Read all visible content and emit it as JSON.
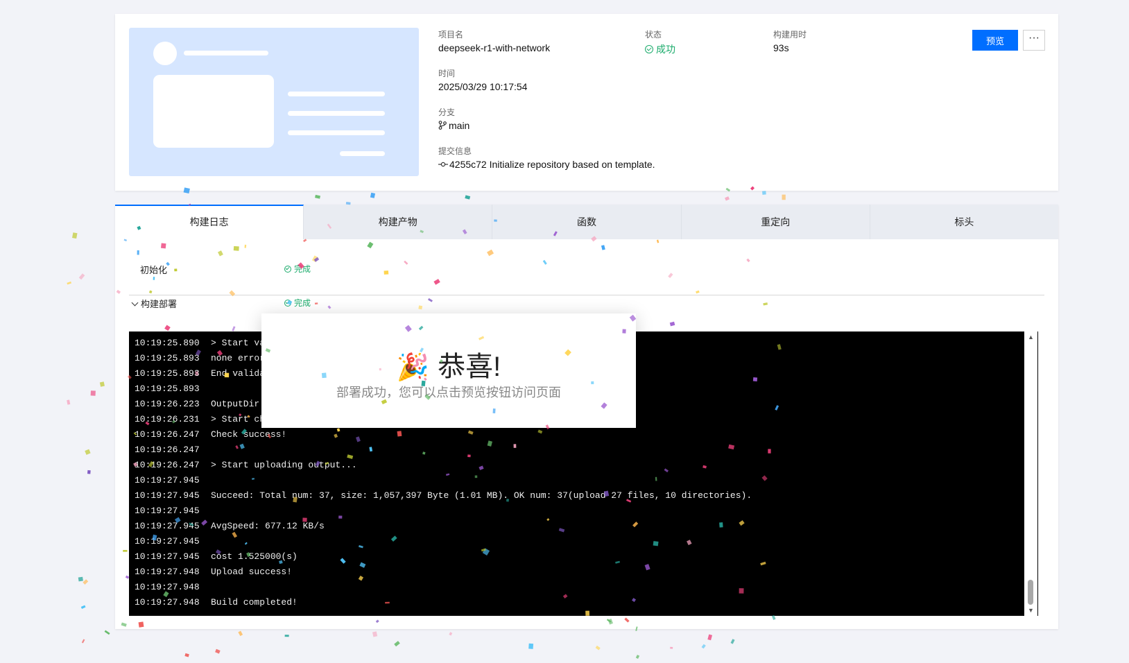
{
  "project": {
    "name_label": "项目名",
    "name": "deepseek-r1-with-network",
    "status_label": "状态",
    "status": "成功",
    "duration_label": "构建用时",
    "duration": "93s",
    "time_label": "时间",
    "time": "2025/03/29 10:17:54",
    "branch_label": "分支",
    "branch": "main",
    "commit_label": "提交信息",
    "commit": "4255c72 Initialize repository based on template.",
    "preview_button": "预览",
    "more_button": "···"
  },
  "tabs": [
    "构建日志",
    "构建产物",
    "函数",
    "重定向",
    "标头"
  ],
  "steps": [
    {
      "name": "初始化",
      "status": "完成"
    },
    {
      "name": "构建部署",
      "status": "完成"
    }
  ],
  "log": [
    {
      "ts": "10:19:25.890",
      "msg": "> Start va"
    },
    {
      "ts": "10:19:25.893",
      "msg": "none error"
    },
    {
      "ts": "10:19:25.893",
      "msg": "End valida"
    },
    {
      "ts": "10:19:25.893",
      "msg": ""
    },
    {
      "ts": "10:19:26.223",
      "msg": "OutputDir"
    },
    {
      "ts": "10:19:26.231",
      "msg": "> Start ch"
    },
    {
      "ts": "10:19:26.247",
      "msg": "Check success!"
    },
    {
      "ts": "10:19:26.247",
      "msg": ""
    },
    {
      "ts": "10:19:26.247",
      "msg": "> Start uploading output..."
    },
    {
      "ts": "10:19:27.945",
      "msg": ""
    },
    {
      "ts": "10:19:27.945",
      "msg": "Succeed: Total num: 37, size: 1,057,397 Byte (1.01 MB). OK num: 37(upload 27 files, 10 directories)."
    },
    {
      "ts": "10:19:27.945",
      "msg": ""
    },
    {
      "ts": "10:19:27.945",
      "msg": "AvgSpeed: 677.12 KB/s"
    },
    {
      "ts": "10:19:27.945",
      "msg": ""
    },
    {
      "ts": "10:19:27.945",
      "msg": "cost 1.525000(s)"
    },
    {
      "ts": "10:19:27.948",
      "msg": "Upload success!"
    },
    {
      "ts": "10:19:27.948",
      "msg": ""
    },
    {
      "ts": "10:19:27.948",
      "msg": "Build completed!"
    }
  ],
  "modal": {
    "icon": "party-popper-icon",
    "title": "恭喜!",
    "subtitle": "部署成功，您可以点击预览按钮访问页面"
  },
  "colors": {
    "accent": "#006eff",
    "success": "#1aab6b",
    "thumb_bg": "#d6e6ff"
  }
}
